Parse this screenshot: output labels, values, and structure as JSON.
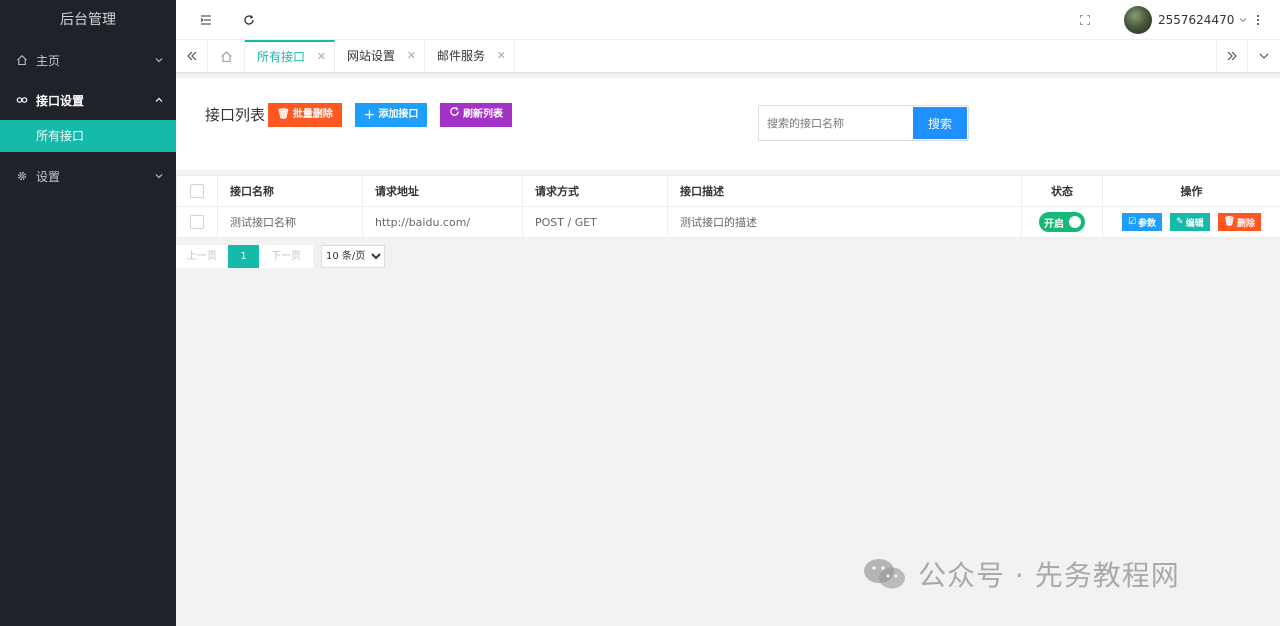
{
  "sidebar": {
    "logo": "后台管理",
    "items": [
      {
        "label": "主页",
        "icon": "home-icon"
      },
      {
        "label": "接口设置",
        "icon": "link-icon"
      },
      {
        "label": "设置",
        "icon": "gear-icon"
      }
    ],
    "active_child": "所有接口"
  },
  "topbar": {
    "username": "2557624470"
  },
  "tabs": [
    {
      "label": "所有接口",
      "active": true
    },
    {
      "label": "网站设置",
      "active": false
    },
    {
      "label": "邮件服务",
      "active": false
    }
  ],
  "toolbar": {
    "title": "接口列表",
    "batch_delete": "批量删除",
    "add": "添加接口",
    "refresh": "刷新列表",
    "search_placeholder": "搜索的接口名称",
    "search_button": "搜索"
  },
  "table": {
    "headers": [
      "接口名称",
      "请求地址",
      "请求方式",
      "接口描述",
      "状态",
      "操作"
    ],
    "rows": [
      {
        "name": "测试接口名称",
        "url": "http://baidu.com/",
        "method": "POST / GET",
        "desc": "测试接口的描述",
        "status": "开启"
      }
    ],
    "actions": {
      "params": "参数",
      "edit": "编辑",
      "delete": "删除"
    }
  },
  "pager": {
    "prev": "上一页",
    "current": "1",
    "next": "下一页",
    "page_size": "10 条/页"
  },
  "watermark": "公众号 · 先务教程网",
  "colors": {
    "sidebar_bg": "#20222a",
    "accent": "#16baaa",
    "danger": "#ff5722",
    "normal": "#1e9fff",
    "purple": "#a233c6",
    "search_btn": "#1e90ff",
    "switch_on": "#16b777"
  }
}
